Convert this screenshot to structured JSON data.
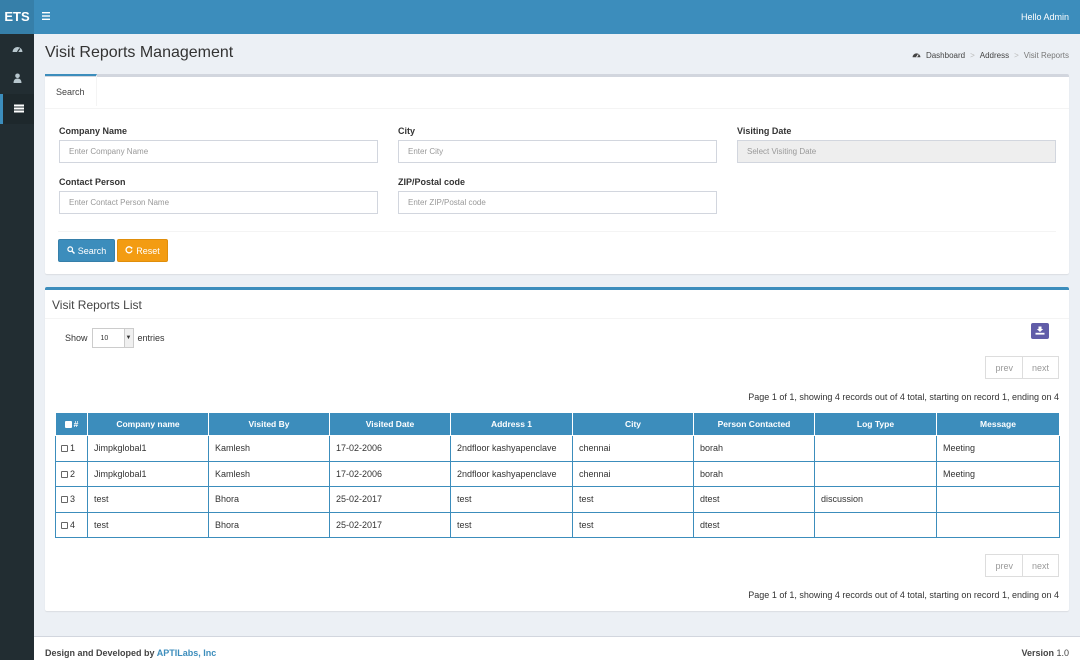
{
  "header": {
    "logo": "ETS",
    "menu_icon": "hamburger-icon",
    "greeting": "Hello Admin",
    "accent": "#3c8dbc"
  },
  "sidebar": {
    "items": [
      {
        "icon": "dashboard-icon",
        "active": false
      },
      {
        "icon": "user-secret-icon",
        "active": false
      },
      {
        "icon": "list-icon",
        "active": true
      }
    ]
  },
  "page": {
    "title": "Visit Reports Management"
  },
  "breadcrumb": {
    "items": [
      "Dashboard",
      "Address",
      "Visit Reports"
    ]
  },
  "search": {
    "tab_label": "Search",
    "company_label": "Company Name",
    "company_placeholder": "Enter Company Name",
    "city_label": "City",
    "city_placeholder": "Enter City",
    "date_label": "Visiting Date",
    "date_placeholder": "Select Visiting Date",
    "contact_label": "Contact Person",
    "contact_placeholder": "Enter Contact Person Name",
    "zip_label": "ZIP/Postal code",
    "zip_placeholder": "Enter ZIP/Postal code",
    "search_button": "Search",
    "reset_button": "Reset"
  },
  "list": {
    "title": "Visit Reports List",
    "show_label": "Show",
    "entries_value": "10",
    "entries_label": "entries",
    "prev": "prev",
    "next": "next",
    "page_info": "Page 1 of 1, showing 4 records out of 4 total, starting on record 1, ending on 4",
    "columns": [
      "#",
      "Company name",
      "Visited By",
      "Visited Date",
      "Address 1",
      "City",
      "Person Contacted",
      "Log Type",
      "Message"
    ],
    "rows": [
      [
        "1",
        "Jimpkglobal1",
        "Kamlesh",
        "17-02-2006",
        "2ndfloor kashyapenclave",
        "chennai",
        "borah",
        "",
        "Meeting"
      ],
      [
        "2",
        "Jimpkglobal1",
        "Kamlesh",
        "17-02-2006",
        "2ndfloor kashyapenclave",
        "chennai",
        "borah",
        "",
        "Meeting"
      ],
      [
        "3",
        "test",
        "Bhora",
        "25-02-2017",
        "test",
        "test",
        "dtest",
        "discussion",
        ""
      ],
      [
        "4",
        "test",
        "Bhora",
        "25-02-2017",
        "test",
        "test",
        "dtest",
        "",
        ""
      ]
    ]
  },
  "footer": {
    "designed_by": "Design and Developed by",
    "company": "APTILabs, Inc",
    "version_label": "Version",
    "version": "1.0"
  }
}
